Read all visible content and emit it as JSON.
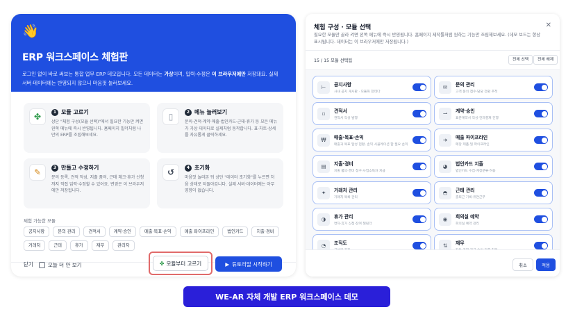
{
  "hero": {
    "emoji": "👋",
    "title": "ERP 워크스페이스 체험판",
    "desc_1": "로그인 없이 바로 써보는 통합 업무 ERP 데모입니다. 모든 데이터는 ",
    "desc_bold_1": "가상",
    "desc_2": "이며, 입력·수정은 ",
    "desc_bold_2": "이 브라우저에만",
    "desc_3": " 저장돼요. 실제 서버·데이터에는 반영되지 않으니 마음껏 눌러보세요."
  },
  "steps": [
    {
      "num": "1",
      "title": "모듈 고르기",
      "icon": "puzzle-icon",
      "desc": "상단 \"체험 구성(모듈 선택)\"에서 필요한 기능만 켜면 왼쪽 메뉴에 즉시 반영됩니다. 홈페이지 빌더처럼 나만의 ERP를 조립해보세요."
    },
    {
      "num": "2",
      "title": "메뉴 눌러보기",
      "icon": "document-icon",
      "desc": "문의·견적·계약·매출·법인카드·근태·휴가 등 모든 메뉴가 가상 데이터로 실제처럼 동작합니다. 표·차트·상세를 자유롭게 클릭하세요."
    },
    {
      "num": "3",
      "title": "만들고 수정하기",
      "icon": "pencil-icon",
      "desc": "문의 등록, 견적 작성, 지출 품의, 근태 체크·휴가 신청까지 직접 입력·수정할 수 있어요. 변경은 이 브라우저에만 저장됩니다."
    },
    {
      "num": "4",
      "title": "초기화",
      "icon": "reset-icon",
      "desc": "마음껏 눌러본 뒤 상단 \"데이터 초기화\"를 누르면 처음 상태로 되돌아갑니다. 실제 서버·데이터에는 아무 영향이 없습니다."
    }
  ],
  "available": {
    "label": "체험 가능한 모듈",
    "chips": [
      "공지사항",
      "문의 관리",
      "견적서",
      "계약·승인",
      "매출·목표·손익",
      "매출 파이프라인",
      "법인카드",
      "지출·경비",
      "거래처",
      "근태",
      "휴가",
      "재무",
      "관리자"
    ]
  },
  "footer": {
    "close": "닫기",
    "dont_show": "오늘 더 안 보기",
    "modules_btn": "모듈부터 고르기",
    "modules_icon": "puzzle-icon",
    "tour_btn": "튜토리얼 시작하기",
    "tour_icon": "play-icon"
  },
  "panel": {
    "title": "체험 구성 · 모듈 선택",
    "subtitle": "필요한 모듈만 골라 켜면 왼쪽 메뉴에 즉시 반영됩니다. 홈페이지 제작툴처럼 원하는 기능만 조립해보세요. (데모 보드는 항상 표시됩니다. 데이터는 이 브라우저에만 저장됩니다.)",
    "count": "15 / 15 모듈 선택됨",
    "select_all": "전체 선택",
    "deselect_all": "전체 해제",
    "cancel": "취소",
    "apply": "적용",
    "accent_color": "#1f4fe0",
    "modules": [
      {
        "name": "공지사항",
        "desc": "사내 공지 게시판 · 모듈화 한데다",
        "icon": "megaphone-icon",
        "glyph": "⊢",
        "on": true
      },
      {
        "name": "문의 관리",
        "desc": "고객 문의 접수·담당 전환 추적",
        "icon": "chat-icon",
        "glyph": "✉",
        "on": true
      },
      {
        "name": "견적서",
        "desc": "견적서 작성·발행",
        "icon": "document-icon",
        "glyph": "▫",
        "on": true
      },
      {
        "name": "계약·승인",
        "desc": "표준계약서 작성·전자결재 진행",
        "icon": "contract-icon",
        "glyph": "⇀",
        "on": true
      },
      {
        "name": "매출·목표·손익",
        "desc": "매출과 목표 달성 현황, 손익 시뮬레이션 합 필요 손익",
        "icon": "won-icon",
        "glyph": "₩",
        "on": true
      },
      {
        "name": "매출 파이프라인",
        "desc": "매장 제품·딜 파이프라인",
        "icon": "pipeline-icon",
        "glyph": "➜",
        "on": true
      },
      {
        "name": "지출·경비",
        "desc": "지출 품의·경비 청구·사업소득자 지급",
        "icon": "receipt-icon",
        "glyph": "▤",
        "on": true
      },
      {
        "name": "법인카드 지출",
        "desc": "법인카드 수집·계정분류·허용",
        "icon": "card-icon",
        "glyph": "◕",
        "on": true
      },
      {
        "name": "거래처 관리",
        "desc": "거래처 목록·관리",
        "icon": "partner-icon",
        "glyph": "✦",
        "on": true
      },
      {
        "name": "근태 관리",
        "desc": "출퇴근 기록·유연근무",
        "icon": "clock-icon",
        "glyph": "◓",
        "on": true
      },
      {
        "name": "휴가 관리",
        "desc": "연차·휴가 신청·잔여 챌린더",
        "icon": "calendar-icon",
        "glyph": "◑",
        "on": true
      },
      {
        "name": "회의실 예약",
        "desc": "회의실 예약 관리",
        "icon": "meeting-room-icon",
        "glyph": "◉",
        "on": true
      },
      {
        "name": "조직도",
        "desc": "구성원·조직",
        "icon": "org-chart-icon",
        "glyph": "◔",
        "on": true
      },
      {
        "name": "재무",
        "desc": "잔동 조회·자금 승인·기증 처리",
        "icon": "finance-icon",
        "glyph": "⇅",
        "on": true
      }
    ]
  },
  "caption": "WE-AR 자체 개발 ERP 워크스페이스 데모"
}
